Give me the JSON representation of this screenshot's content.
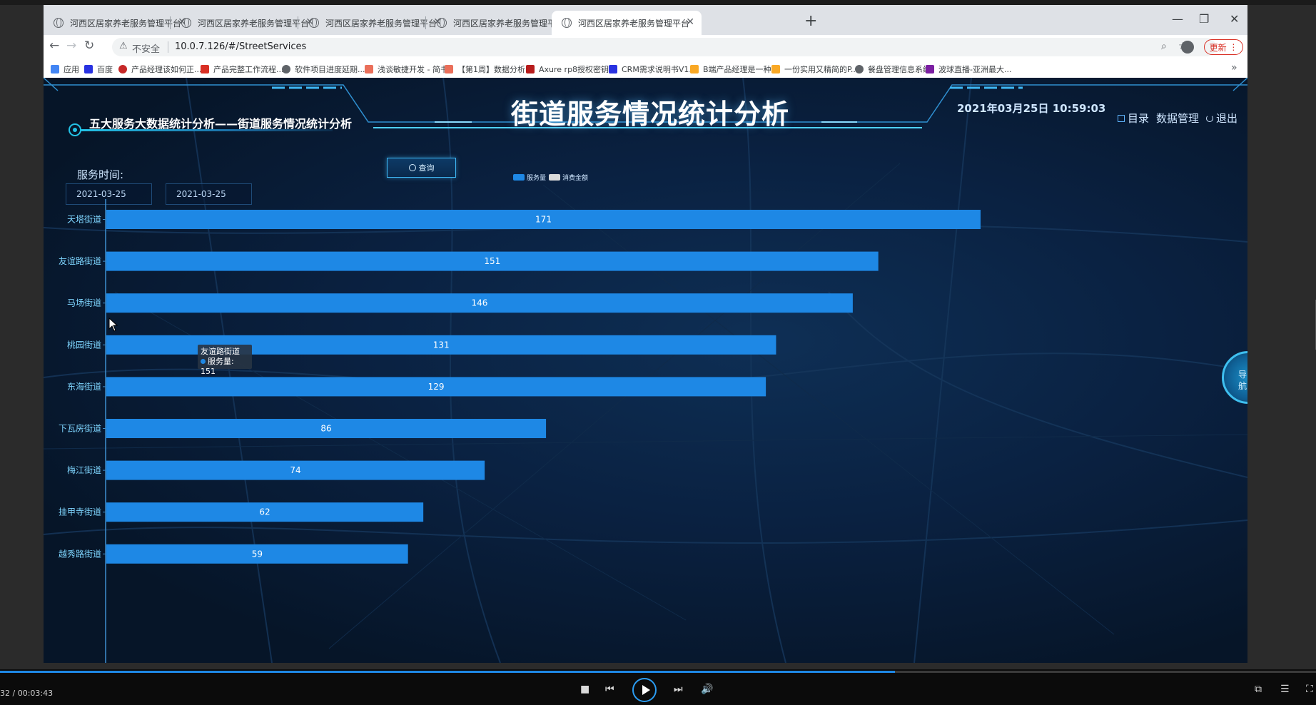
{
  "browser": {
    "tabs": [
      {
        "title": "河西区居家养老服务管理平台",
        "active": false
      },
      {
        "title": "河西区居家养老服务管理平台",
        "active": false
      },
      {
        "title": "河西区居家养老服务管理平台",
        "active": false
      },
      {
        "title": "河西区居家养老服务管理平台",
        "active": false
      },
      {
        "title": "河西区居家养老服务管理平台",
        "active": true
      }
    ],
    "security_label": "不安全",
    "url": "10.0.7.126/#/StreetServices",
    "update_label": "更新",
    "bookmarks": [
      {
        "label": "应用",
        "color": "#4285f4"
      },
      {
        "label": "百度",
        "color": "#2932e1"
      },
      {
        "label": "产品经理该如何正...",
        "color": "#c62828"
      },
      {
        "label": "产品完整工作流程...",
        "color": "#d93025"
      },
      {
        "label": "软件项目进度延期...",
        "color": "#5f6368"
      },
      {
        "label": "浅谈敏捷开发 - 简书",
        "color": "#ea6f5a"
      },
      {
        "label": "【第1周】数据分析...",
        "color": "#ea6f5a"
      },
      {
        "label": "Axure rp8授权密钥...",
        "color": "#b71c1c"
      },
      {
        "label": "CRM需求说明书V1...",
        "color": "#2932e1"
      },
      {
        "label": "B端产品经理是一种...",
        "color": "#f9a825"
      },
      {
        "label": "一份实用又精简的P...",
        "color": "#f9a825"
      },
      {
        "label": "餐盘管理信息系统",
        "color": "#5f6368"
      },
      {
        "label": "波球直播-亚洲最大...",
        "color": "#7b1fa2"
      }
    ]
  },
  "page": {
    "title": "街道服务情况统计分析",
    "datetime": "2021年03月25日 10:59:03",
    "links": {
      "catalog": "目录",
      "data_mgmt": "数据管理",
      "logout": "退出"
    },
    "subtitle": "五大服务大数据统计分析——街道服务情况统计分析",
    "service_time_label": "服务时间:",
    "date_start": "2021-03-25",
    "date_end": "2021-03-25",
    "query_label": "查询",
    "nav_bubble_text": "导航"
  },
  "chart_data": {
    "type": "bar",
    "orientation": "horizontal",
    "categories": [
      "天塔街道",
      "友谊路街道",
      "马场街道",
      "桃园街道",
      "东海街道",
      "下瓦房街道",
      "梅江街道",
      "挂甲寺街道",
      "越秀路街道"
    ],
    "series": [
      {
        "name": "服务量",
        "values": [
          171,
          151,
          146,
          131,
          129,
          86,
          74,
          62,
          59
        ],
        "color": "#1e88e5"
      },
      {
        "name": "消费金额",
        "values": [],
        "color": "#d9d9d9"
      }
    ],
    "data_labels": true,
    "legend_position": "top-center",
    "tooltip": {
      "category": "友谊路街道",
      "series": "服务量",
      "value": 151
    }
  },
  "player": {
    "time": "32 / 00:03:43",
    "progress_fraction": 0.68
  },
  "colors": {
    "accent": "#1e88e5",
    "page_bg": "#0a2141",
    "title_glow": "#5abeff"
  }
}
